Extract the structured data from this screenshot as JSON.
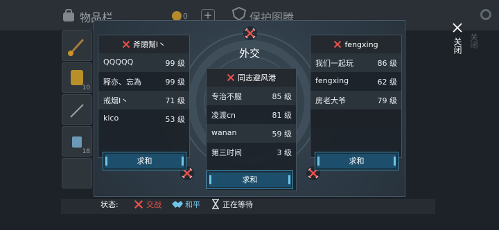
{
  "background": {
    "title_left": "物品栏",
    "gold_value": "0",
    "title_right": "保护图腾",
    "slot_counts": [
      "10",
      "18"
    ],
    "scroll_hint": "关闭"
  },
  "panel": {
    "title": "外交",
    "guilds": [
      {
        "name": "斧頭幫I丶",
        "members": [
          {
            "name": "QQQQQ",
            "level": "99 级"
          },
          {
            "name": "释亦、忘為",
            "level": "99 级"
          },
          {
            "name": "戒烟I丶",
            "level": "71 级"
          },
          {
            "name": "kico",
            "level": "53 级"
          }
        ],
        "button": "求和"
      },
      {
        "name": "同志避风港",
        "members": [
          {
            "name": "专治不服",
            "level": "85 级"
          },
          {
            "name": "凌渡cn",
            "level": "81 级"
          },
          {
            "name": "wanan",
            "level": "59 级"
          },
          {
            "name": "第三时间",
            "level": "3 级"
          }
        ],
        "button": "求和"
      },
      {
        "name": "fengxing",
        "members": [
          {
            "name": "我们一起玩",
            "level": "86 级"
          },
          {
            "name": "fengxing",
            "level": "62 级"
          },
          {
            "name": "房老大爷",
            "level": "79 级"
          }
        ],
        "button": "求和"
      }
    ]
  },
  "status_bar": {
    "label": "状态:",
    "war": "交战",
    "peace": "和平",
    "waiting": "正在等待"
  },
  "close_label": "关闭",
  "colors": {
    "war": "#e8524b",
    "peace": "#6fc4e8",
    "button_fill": "#1d4f6c",
    "panel_bg": "#2e3b46"
  },
  "icons": [
    "backpack-icon",
    "gold-coin-icon",
    "plus-icon",
    "shield-icon",
    "crossed-swords-icon",
    "handshake-icon",
    "hourglass-icon",
    "close-icon",
    "gear-icon"
  ]
}
